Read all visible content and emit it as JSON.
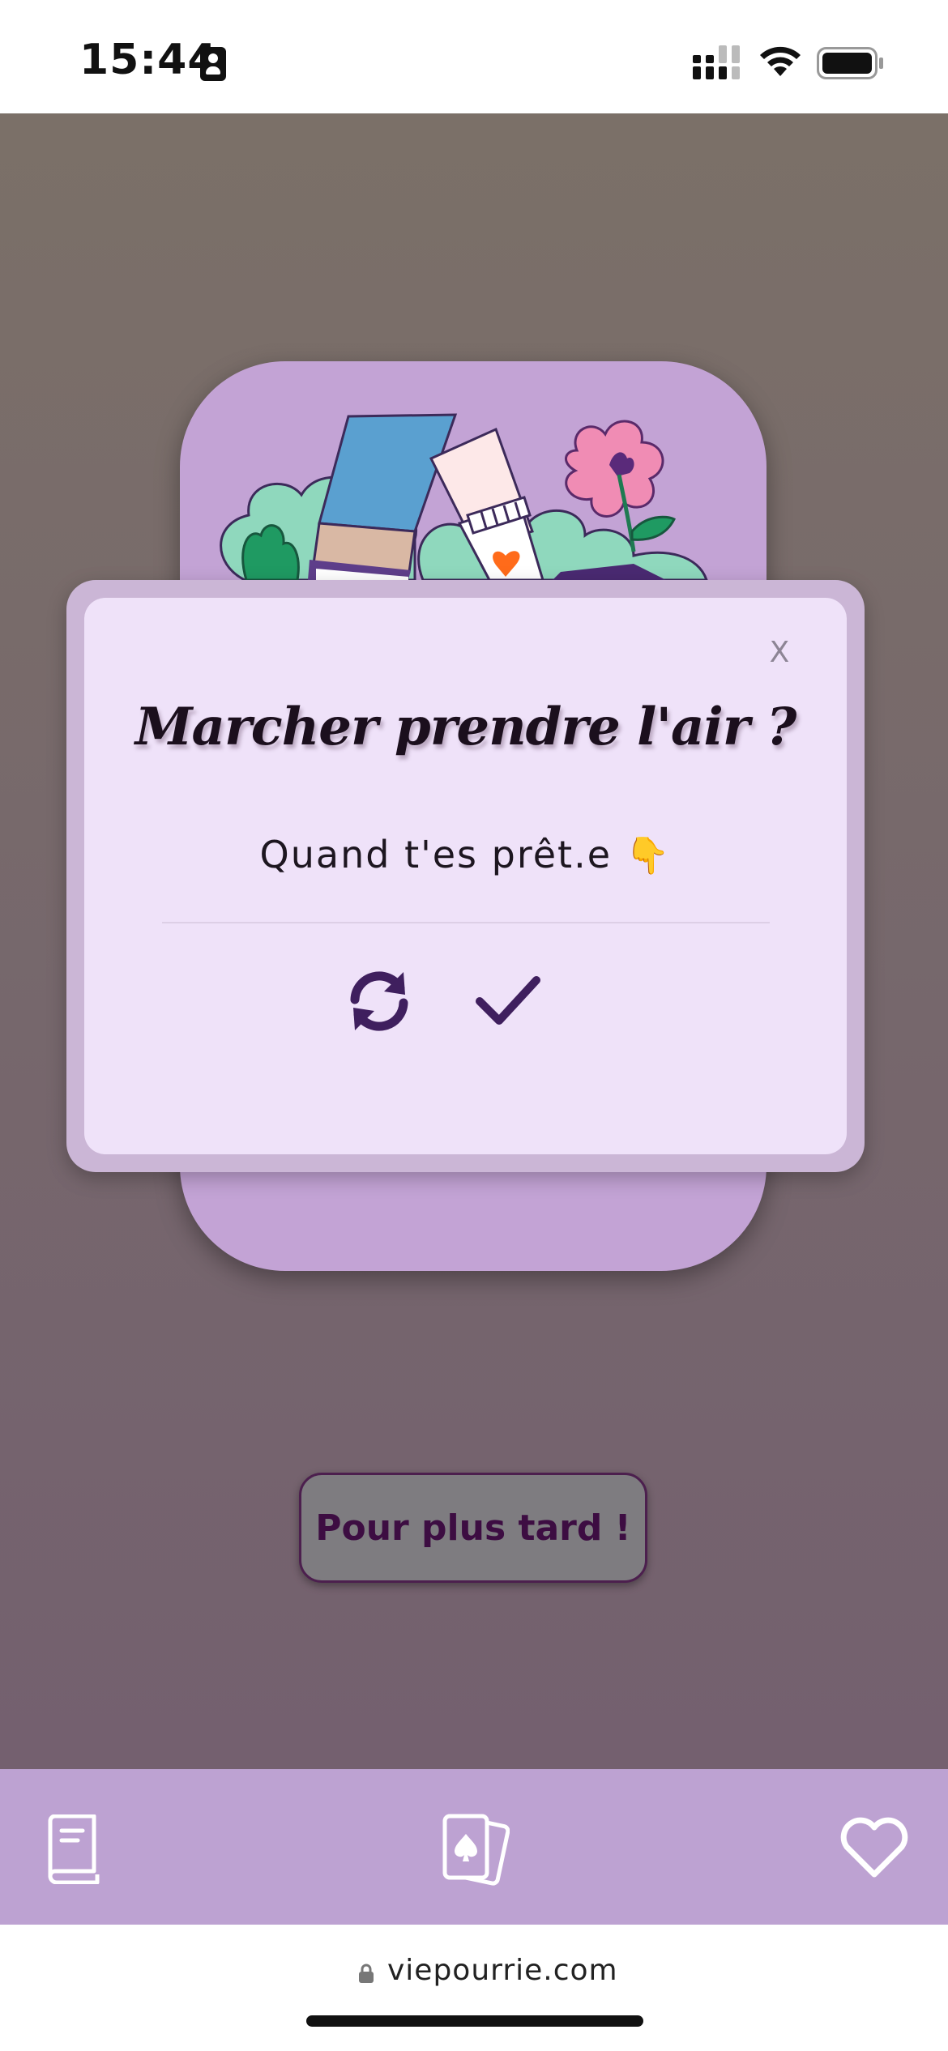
{
  "status_bar": {
    "time": "15:44"
  },
  "modal": {
    "close_label": "X",
    "title": "Marcher prendre l'air ?",
    "subtitle": "Quand t'es prêt.e",
    "subtitle_emoji": "👇"
  },
  "later_button": {
    "label": "Pour plus tard !"
  },
  "bottom_nav": {
    "items": [
      {
        "icon": "book-icon"
      },
      {
        "icon": "cards-spade-icon"
      },
      {
        "icon": "heart-icon"
      }
    ]
  },
  "browser": {
    "url": "viepourrie.com"
  },
  "colors": {
    "card_purple": "#c3a3d5",
    "modal_bg": "#efe2f9",
    "nav_bg": "#bda2d2",
    "icon_dark_purple": "#3f1f5e",
    "button_text": "#3d0d42"
  }
}
